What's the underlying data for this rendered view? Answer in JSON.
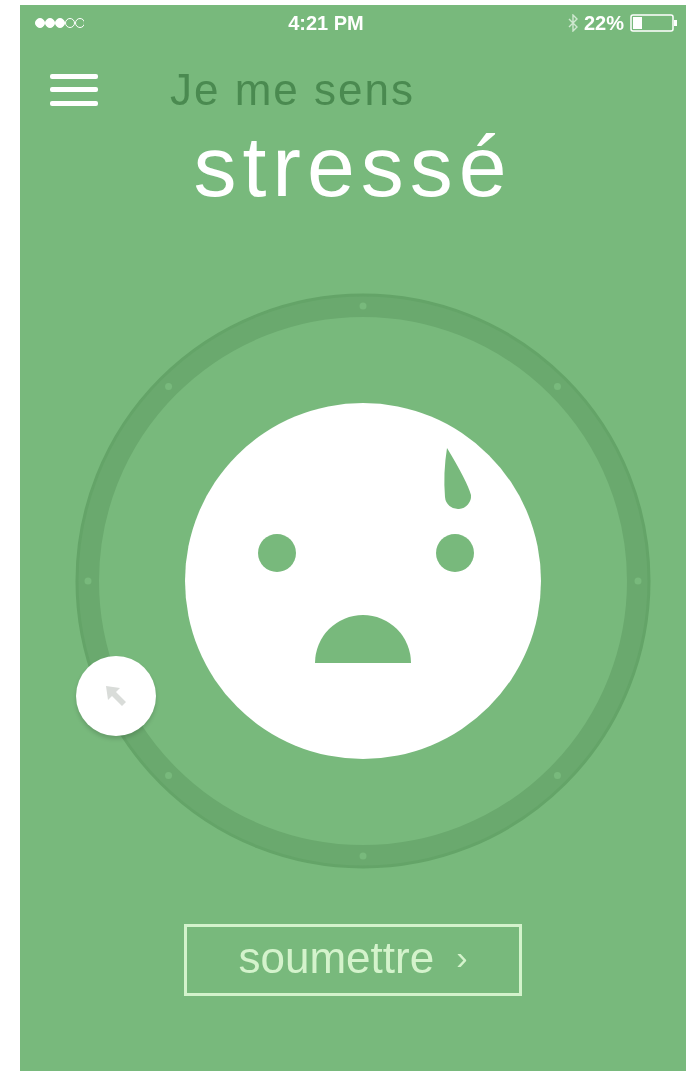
{
  "status_bar": {
    "time": "4:21 PM",
    "battery": "22%"
  },
  "header": {
    "prompt": "Je me sens",
    "mood": "stressé"
  },
  "submit_button": {
    "label": "soumettre",
    "chevron": "›"
  }
}
